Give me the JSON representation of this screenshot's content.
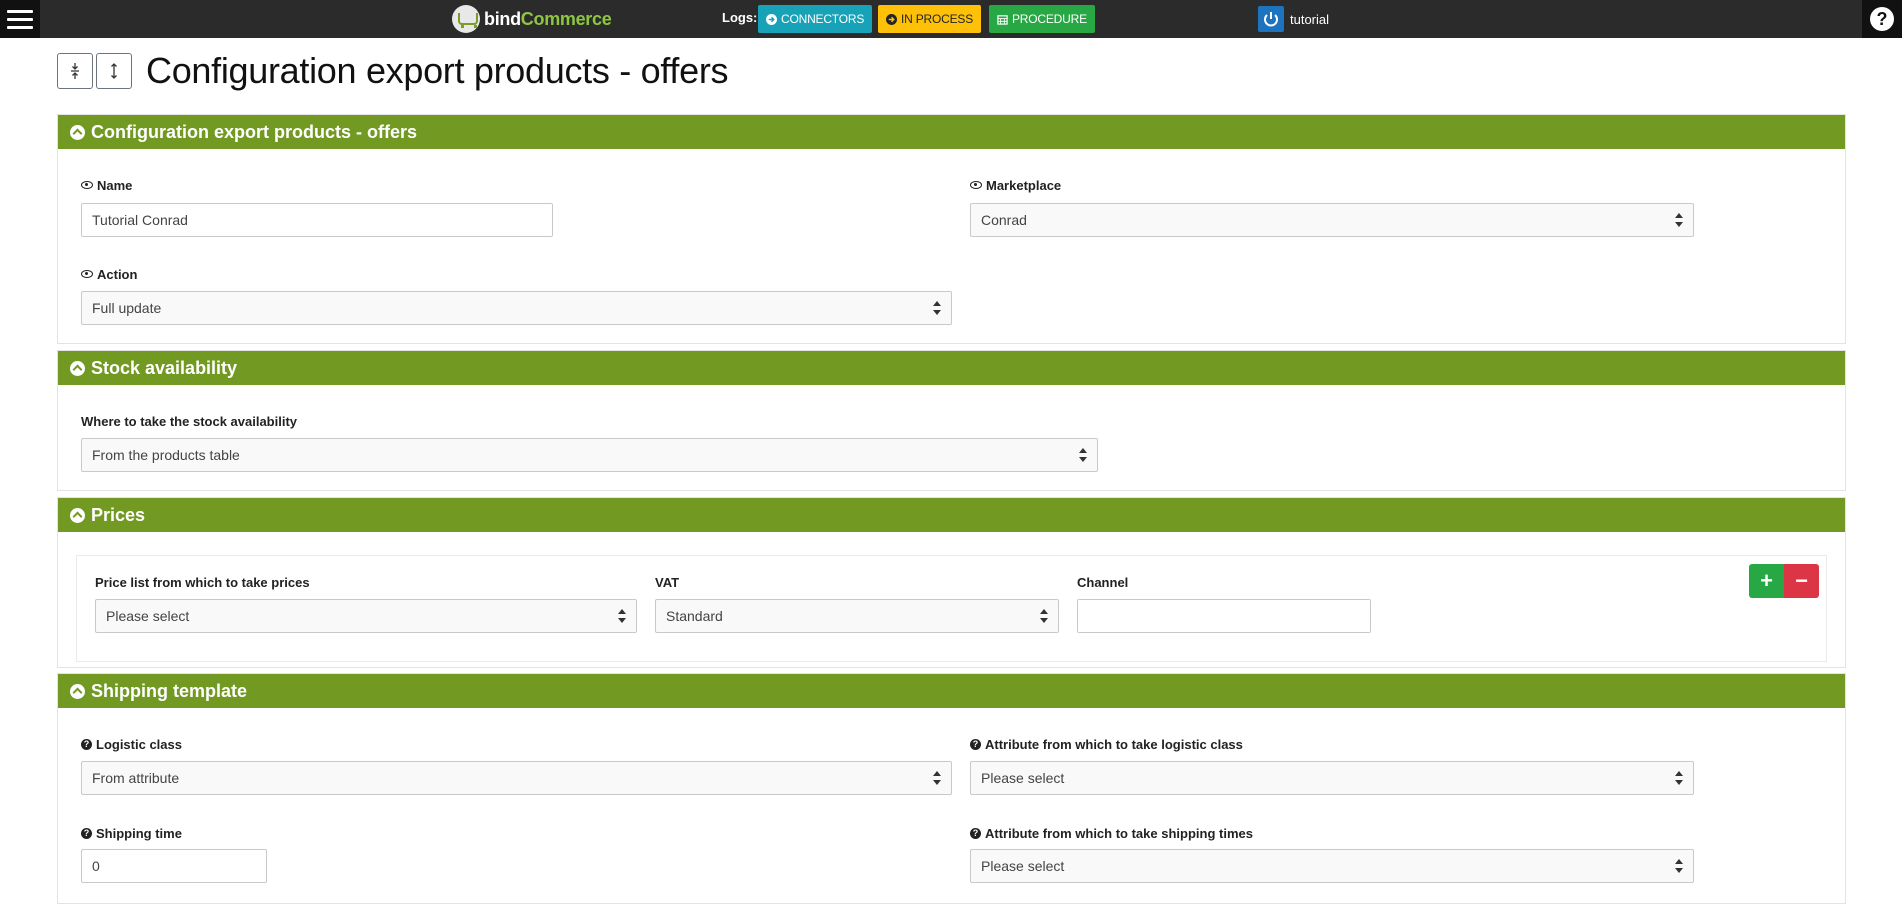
{
  "topbar": {
    "logo_part1": "bind",
    "logo_part2": "Commerce",
    "logs_label": "Logs:",
    "connectors_label": "CONNECTORS",
    "in_process_label": "IN PROCESS",
    "procedure_label": "PROCEDURE",
    "user_name": "tutorial",
    "help_glyph": "?"
  },
  "page_title": "Configuration export products - offers",
  "sections": {
    "config": {
      "title": "Configuration export products - offers",
      "name_label": "Name",
      "name_value": "Tutorial Conrad",
      "marketplace_label": "Marketplace",
      "marketplace_value": "Conrad",
      "action_label": "Action",
      "action_value": "Full update"
    },
    "stock": {
      "title": "Stock availability",
      "where_label": "Where to take the stock availability",
      "where_value": "From the products table"
    },
    "prices": {
      "title": "Prices",
      "price_list_label": "Price list from which to take prices",
      "price_list_value": "Please select",
      "vat_label": "VAT",
      "vat_value": "Standard",
      "channel_label": "Channel",
      "channel_value": "",
      "add_glyph": "+",
      "remove_glyph": "−"
    },
    "shipping": {
      "title": "Shipping template",
      "logistic_class_label": "Logistic class",
      "logistic_class_value": "From attribute",
      "attr_logistic_label": "Attribute from which to take logistic class",
      "attr_logistic_value": "Please select",
      "shipping_time_label": "Shipping time",
      "shipping_time_value": "0",
      "attr_shipping_label": "Attribute from which to take shipping times",
      "attr_shipping_value": "Please select"
    }
  },
  "colors": {
    "section_header": "#729a22",
    "topbar": "#2b2b2b",
    "connectors": "#17a2b8",
    "in_process": "#ffc107",
    "procedure": "#28a745",
    "add": "#28a745",
    "remove": "#dc3545"
  },
  "icons": [
    "menu-icon",
    "cart-logo-icon",
    "arrow-circle-icon",
    "calendar-icon",
    "power-icon",
    "help-icon",
    "collapse-icon",
    "eye-icon",
    "question-icon",
    "select-arrows-icon"
  ]
}
